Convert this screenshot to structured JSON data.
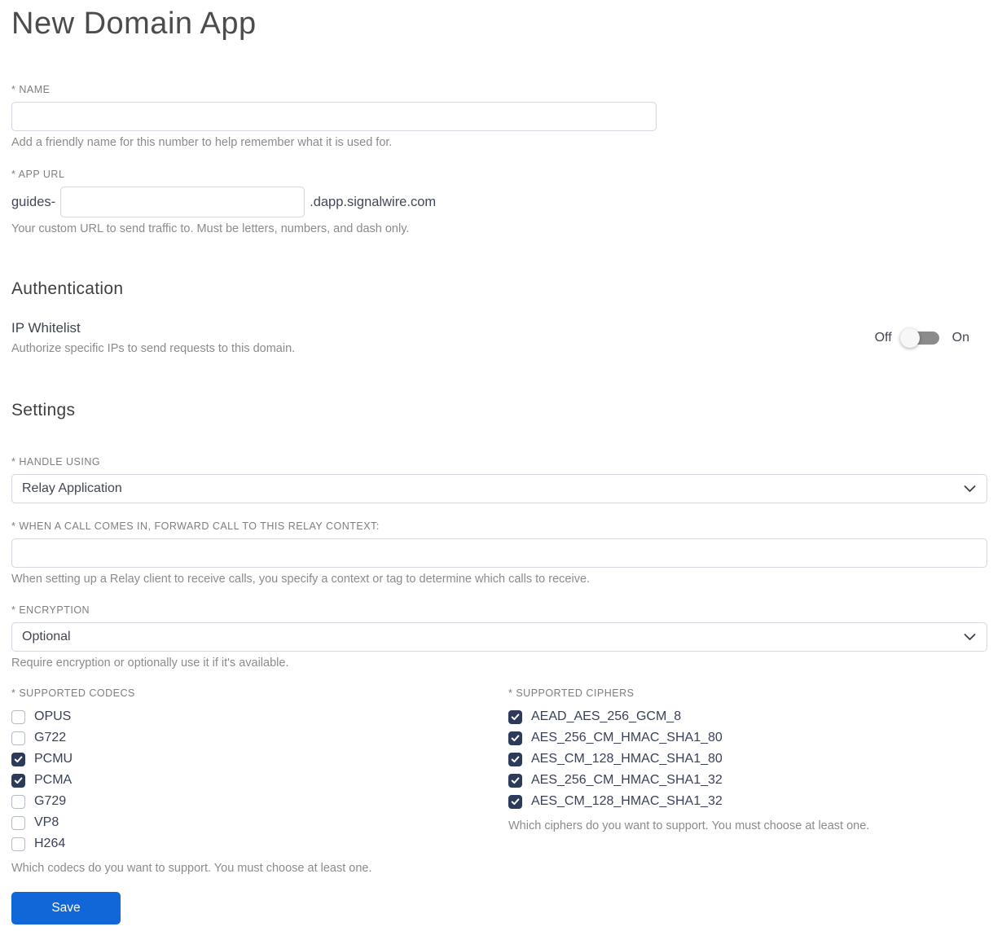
{
  "page": {
    "title": "New Domain App"
  },
  "name_field": {
    "label": "* NAME",
    "value": "",
    "helper": "Add a friendly name for this number to help remember what it is used for."
  },
  "app_url_field": {
    "label": "* APP URL",
    "prefix": "guides-",
    "value": "",
    "suffix": ".dapp.signalwire.com",
    "helper": "Your custom URL to send traffic to. Must be letters, numbers, and dash only."
  },
  "authentication": {
    "heading": "Authentication",
    "ip_whitelist": {
      "label": "IP Whitelist",
      "helper": "Authorize specific IPs to send requests to this domain.",
      "toggle": {
        "off_label": "Off",
        "on_label": "On",
        "state": "off"
      }
    }
  },
  "settings": {
    "heading": "Settings",
    "handle_using": {
      "label": "* HANDLE USING",
      "selected": "Relay Application"
    },
    "relay_context": {
      "label": "* WHEN A CALL COMES IN, FORWARD CALL TO THIS RELAY CONTEXT:",
      "value": "",
      "helper": "When setting up a Relay client to receive calls, you specify a context or tag to determine which calls to receive."
    },
    "encryption": {
      "label": "* ENCRYPTION",
      "selected": "Optional",
      "helper": "Require encryption or optionally use it if it's available."
    },
    "codecs": {
      "label": "* SUPPORTED CODECS",
      "options": [
        {
          "label": "OPUS",
          "checked": false
        },
        {
          "label": "G722",
          "checked": false
        },
        {
          "label": "PCMU",
          "checked": true
        },
        {
          "label": "PCMA",
          "checked": true
        },
        {
          "label": "G729",
          "checked": false
        },
        {
          "label": "VP8",
          "checked": false
        },
        {
          "label": "H264",
          "checked": false
        }
      ],
      "helper": "Which codecs do you want to support. You must choose at least one."
    },
    "ciphers": {
      "label": "* SUPPORTED CIPHERS",
      "options": [
        {
          "label": "AEAD_AES_256_GCM_8",
          "checked": true
        },
        {
          "label": "AES_256_CM_HMAC_SHA1_80",
          "checked": true
        },
        {
          "label": "AES_CM_128_HMAC_SHA1_80",
          "checked": true
        },
        {
          "label": "AES_256_CM_HMAC_SHA1_32",
          "checked": true
        },
        {
          "label": "AES_CM_128_HMAC_SHA1_32",
          "checked": true
        }
      ],
      "helper": "Which ciphers do you want to support. You must choose at least one."
    }
  },
  "actions": {
    "save_label": "Save"
  },
  "colors": {
    "accent_blue": "#1267d8",
    "checkbox_checked": "#2e3a59",
    "toggle_track": "#8b8b8b",
    "input_border": "#d3d7df",
    "label_gray": "#7e7e7e",
    "helper_gray": "#8b8b8b"
  }
}
